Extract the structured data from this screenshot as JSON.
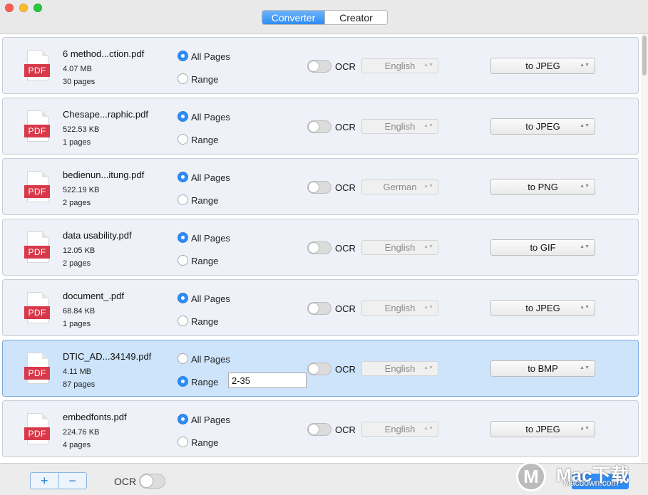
{
  "tabs": [
    {
      "label": "Converter",
      "active": true
    },
    {
      "label": "Creator",
      "active": false
    }
  ],
  "icon_label": "PDF",
  "radio_labels": {
    "all": "All Pages",
    "range": "Range"
  },
  "ocr_label": "OCR",
  "files": [
    {
      "name": "6 method...ction.pdf",
      "size": "4.07 MB",
      "pages": "30 pages",
      "mode": "all",
      "range": "",
      "ocr": false,
      "language": "English",
      "format": "to JPEG",
      "selected": false
    },
    {
      "name": "Chesape...raphic.pdf",
      "size": "522.53 KB",
      "pages": "1 pages",
      "mode": "all",
      "range": "",
      "ocr": false,
      "language": "English",
      "format": "to JPEG",
      "selected": false
    },
    {
      "name": "bedienun...itung.pdf",
      "size": "522.19 KB",
      "pages": "2 pages",
      "mode": "all",
      "range": "",
      "ocr": false,
      "language": "German",
      "format": "to PNG",
      "selected": false
    },
    {
      "name": "data usability.pdf",
      "size": "12.05 KB",
      "pages": "2 pages",
      "mode": "all",
      "range": "",
      "ocr": false,
      "language": "English",
      "format": "to GIF",
      "selected": false
    },
    {
      "name": "document_.pdf",
      "size": "68.84 KB",
      "pages": "1 pages",
      "mode": "all",
      "range": "",
      "ocr": false,
      "language": "English",
      "format": "to JPEG",
      "selected": false
    },
    {
      "name": "DTIC_AD...34149.pdf",
      "size": "4.11 MB",
      "pages": "87 pages",
      "mode": "range",
      "range": "2-35",
      "ocr": false,
      "language": "English",
      "format": "to BMP",
      "selected": true
    },
    {
      "name": "embedfonts.pdf",
      "size": "224.76 KB",
      "pages": "4 pages",
      "mode": "all",
      "range": "",
      "ocr": false,
      "language": "English",
      "format": "to JPEG",
      "selected": false
    }
  ],
  "bottom": {
    "add": "+",
    "remove": "−",
    "ocr_label": "OCR",
    "ocr_on": false
  },
  "watermark": {
    "logo_letter": "M",
    "text": "Mac下载",
    "url": "Macdown.com"
  },
  "colors": {
    "accent": "#2f8cf5",
    "pdf_red": "#d8394a",
    "selected_row": "#cde4fb"
  }
}
